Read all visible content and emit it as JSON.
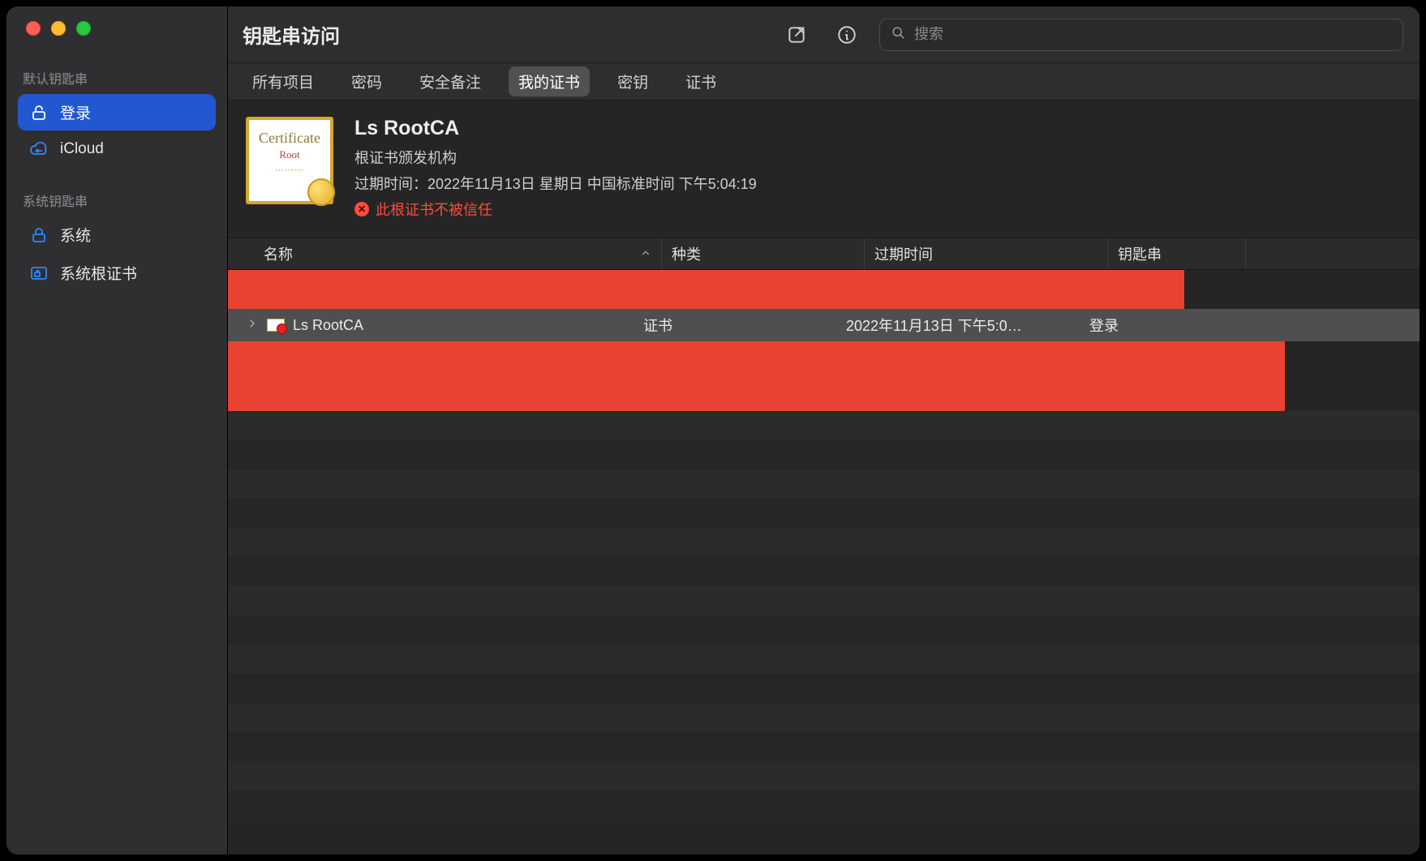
{
  "window": {
    "title": "钥匙串访问"
  },
  "search": {
    "placeholder": "搜索"
  },
  "sidebar": {
    "sections": [
      {
        "label": "默认钥匙串",
        "items": [
          {
            "icon": "unlock-icon",
            "label": "登录",
            "selected": true
          },
          {
            "icon": "cloud-key-icon",
            "label": "iCloud",
            "selected": false
          }
        ]
      },
      {
        "label": "系统钥匙串",
        "items": [
          {
            "icon": "lock-icon",
            "label": "系统",
            "selected": false
          },
          {
            "icon": "cert-store-icon",
            "label": "系统根证书",
            "selected": false
          }
        ]
      }
    ]
  },
  "tabs": [
    {
      "label": "所有项目",
      "active": false
    },
    {
      "label": "密码",
      "active": false
    },
    {
      "label": "安全备注",
      "active": false
    },
    {
      "label": "我的证书",
      "active": true
    },
    {
      "label": "密钥",
      "active": false
    },
    {
      "label": "证书",
      "active": false
    }
  ],
  "detail": {
    "name": "Ls RootCA",
    "kind": "根证书颁发机构",
    "expiry_line": "过期时间：2022年11月13日 星期日 中国标准时间 下午5:04:19",
    "trust_warning": "此根证书不被信任"
  },
  "columns": {
    "name": "名称",
    "kind": "种类",
    "expiry": "过期时间",
    "keychain": "钥匙串"
  },
  "rows": [
    {
      "name": "Ls RootCA",
      "kind": "证书",
      "expiry": "2022年11月13日 下午5:0…",
      "keychain": "登录"
    }
  ]
}
